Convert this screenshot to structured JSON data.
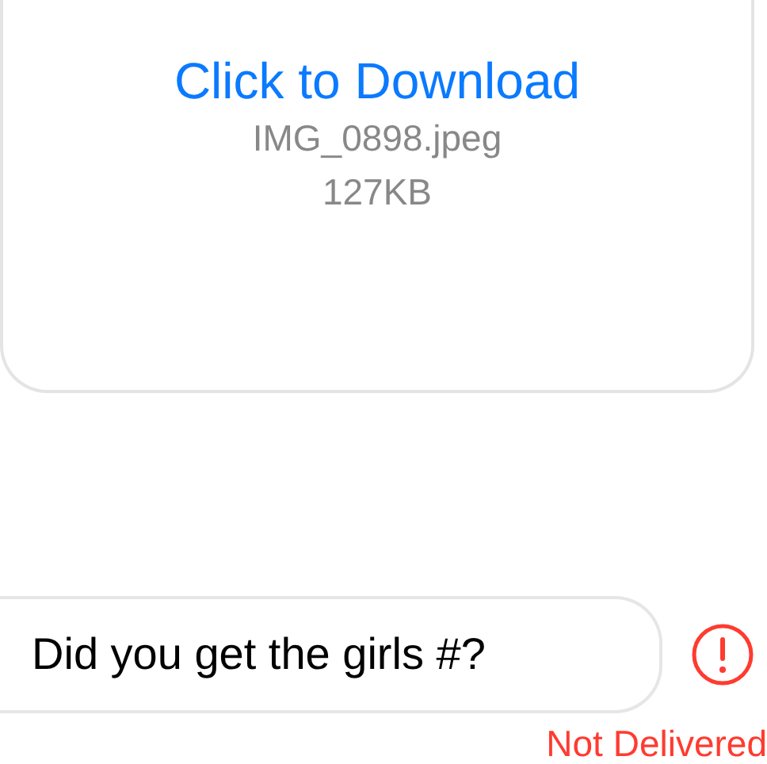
{
  "messages": [
    {
      "kind": "attachment",
      "link": "Click to Download",
      "filename": "IMG_0898.jpeg",
      "size": "127KB"
    },
    {
      "kind": "text",
      "text": "Did you get the girls #?",
      "delivered": false,
      "status": "Not Delivered"
    }
  ]
}
